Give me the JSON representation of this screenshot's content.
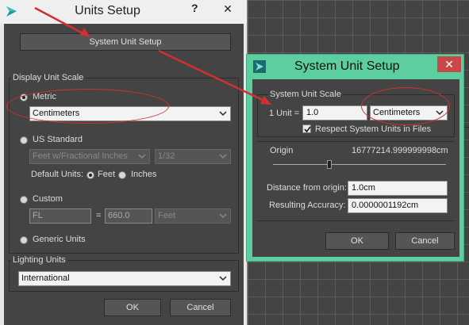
{
  "units_setup": {
    "title": "Units Setup",
    "help_label": "?",
    "close_label": "✕",
    "system_unit_setup_button": "System Unit Setup",
    "display_unit_scale": {
      "group_label": "Display Unit Scale",
      "metric_label": "Metric",
      "metric_selected": true,
      "metric_value": "Centimeters",
      "us_standard_label": "US Standard",
      "us_value": "Feet w/Fractional Inches",
      "us_fraction": "1/32",
      "default_units_label": "Default Units:",
      "feet_label": "Feet",
      "inches_label": "Inches",
      "custom_label": "Custom",
      "custom_name": "FL",
      "custom_equals": "=",
      "custom_value": "660.0",
      "custom_unit": "Feet",
      "generic_units_label": "Generic Units"
    },
    "lighting_units": {
      "group_label": "Lighting Units",
      "value": "International"
    },
    "ok_label": "OK",
    "cancel_label": "Cancel"
  },
  "system_unit_setup": {
    "title": "System Unit Setup",
    "close_label": "✕",
    "scale_group_label": "System Unit Scale",
    "one_unit_label": "1 Unit =",
    "one_unit_value": "1.0",
    "unit_value": "Centimeters",
    "respect_label": "Respect System Units in Files",
    "respect_checked": true,
    "origin_label": "Origin",
    "origin_value": "16777214.999999998cm",
    "distance_label": "Distance from origin:",
    "distance_value": "1.0cm",
    "accuracy_label": "Resulting Accuracy:",
    "accuracy_value": "0.0000001192cm",
    "ok_label": "OK",
    "cancel_label": "Cancel"
  },
  "colors": {
    "accent_title": "#5ccea0",
    "close_red": "#c84848",
    "annotation_red": "#d23030"
  }
}
